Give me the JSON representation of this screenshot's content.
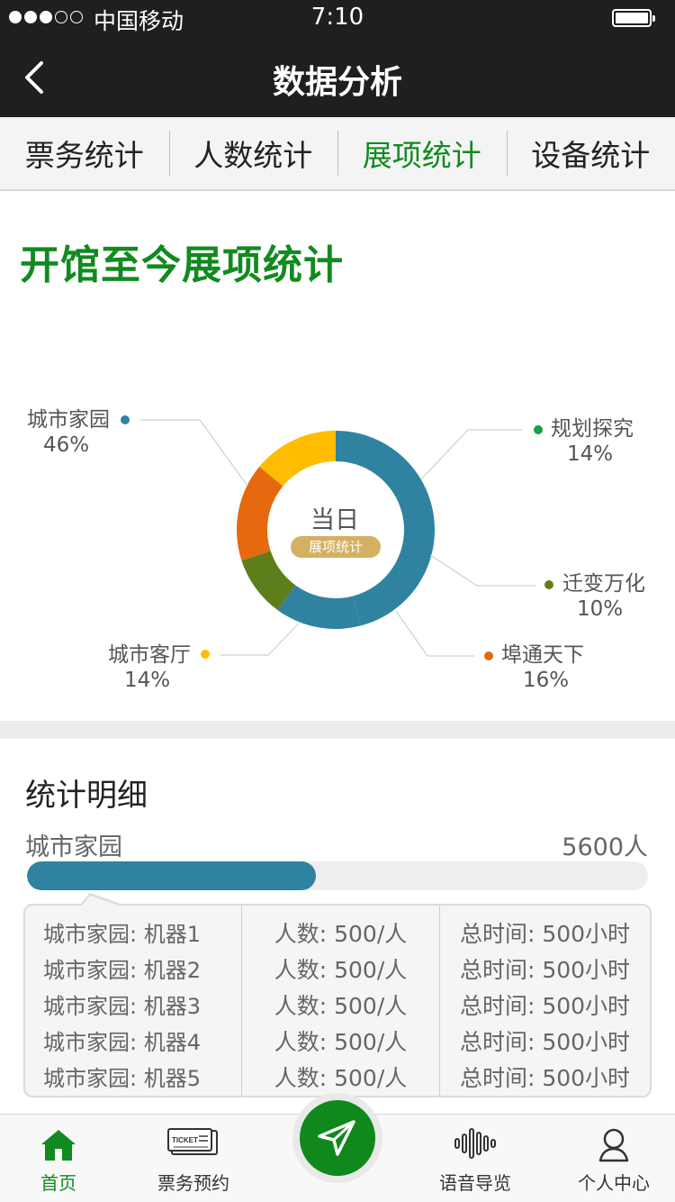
{
  "status_bar": {
    "carrier": "中国移动",
    "time": "7:10"
  },
  "header": {
    "title": "数据分析"
  },
  "tabs": [
    {
      "label": "票务统计",
      "active": false
    },
    {
      "label": "人数统计",
      "active": false
    },
    {
      "label": "展项统计",
      "active": true
    },
    {
      "label": "设备统计",
      "active": false
    }
  ],
  "section": {
    "title": "开馆至今展项统计"
  },
  "chart_data": {
    "type": "pie",
    "center_label": "当日",
    "center_badge": "展项统计",
    "slices": [
      {
        "label": "城市家园",
        "value": 46,
        "display": "46%",
        "color": "#2f83a0"
      },
      {
        "label": "规划探究",
        "value": 14,
        "display": "14%",
        "color": "#15a04b"
      },
      {
        "label": "迁变万化",
        "value": 10,
        "display": "10%",
        "color": "#5e7e1c"
      },
      {
        "label": "埠通天下",
        "value": 16,
        "display": "16%",
        "color": "#e5690f"
      },
      {
        "label": "城市客厅",
        "value": 14,
        "display": "14%",
        "color": "#ffbc00"
      }
    ]
  },
  "detail": {
    "title": "统计明细",
    "item_name": "城市家园",
    "item_count": "5600人",
    "progress": 0.465,
    "rows": [
      {
        "machine": "城市家园: 机器1",
        "people": "人数: 500/人",
        "time": "总时间: 500小时"
      },
      {
        "machine": "城市家园: 机器2",
        "people": "人数: 500/人",
        "time": "总时间: 500小时"
      },
      {
        "machine": "城市家园: 机器3",
        "people": "人数: 500/人",
        "time": "总时间: 500小时"
      },
      {
        "machine": "城市家园: 机器4",
        "people": "人数: 500/人",
        "time": "总时间: 500小时"
      },
      {
        "machine": "城市家园: 机器5",
        "people": "人数: 500/人",
        "time": "总时间: 500小时"
      }
    ]
  },
  "bottom_nav": {
    "home": "首页",
    "tickets": "票务预约",
    "audio": "语音导览",
    "profile": "个人中心",
    "ticket_icon_text": "TICKET"
  },
  "colors": {
    "brand_green": "#118a1f",
    "header_bg": "#1f1f1f",
    "progress": "#2f83a0"
  }
}
